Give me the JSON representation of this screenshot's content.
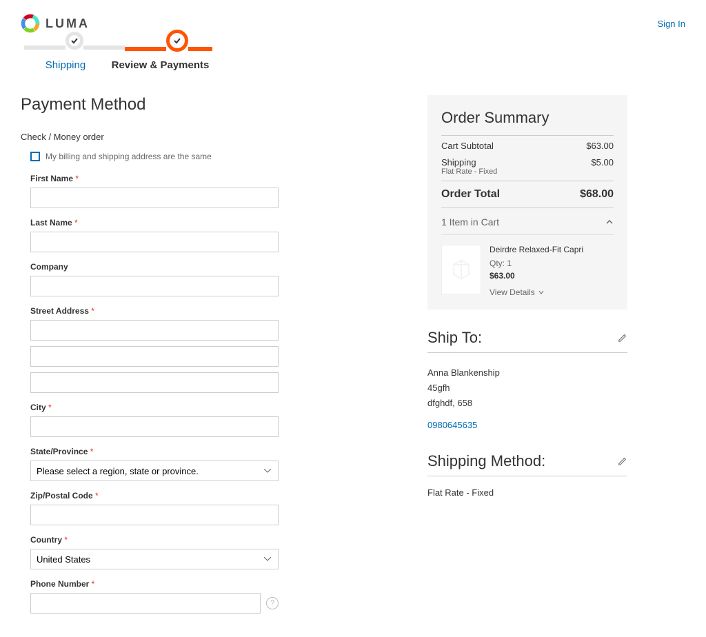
{
  "header": {
    "logo_text": "LUMA",
    "signin": "Sign In"
  },
  "progress": {
    "step1": "Shipping",
    "step2": "Review & Payments"
  },
  "page_title": "Payment Method",
  "payment": {
    "method_label": "Check / Money order",
    "same_address_label": "My billing and shipping address are the same"
  },
  "fields": {
    "first_name": "First Name",
    "last_name": "Last Name",
    "company": "Company",
    "street": "Street Address",
    "city": "City",
    "state": "State/Province",
    "state_placeholder": "Please select a region, state or province.",
    "zip": "Zip/Postal Code",
    "country": "Country",
    "country_value": "United States",
    "phone": "Phone Number"
  },
  "summary": {
    "title": "Order Summary",
    "subtotal_label": "Cart Subtotal",
    "subtotal": "$63.00",
    "shipping_label": "Shipping",
    "shipping_sub": "Flat Rate - Fixed",
    "shipping": "$5.00",
    "total_label": "Order Total",
    "total": "$68.00",
    "cart_count": "1 Item in Cart",
    "item": {
      "name": "Deirdre Relaxed-Fit Capri",
      "qty_label": "Qty: 1",
      "price": "$63.00",
      "view_details": "View Details"
    }
  },
  "shipto": {
    "title": "Ship To:",
    "name": "Anna Blankenship",
    "line1": "45gfh",
    "line2": "dfghdf, 658",
    "phone": "0980645635"
  },
  "shipmethod": {
    "title": "Shipping Method:",
    "value": "Flat Rate - Fixed"
  }
}
